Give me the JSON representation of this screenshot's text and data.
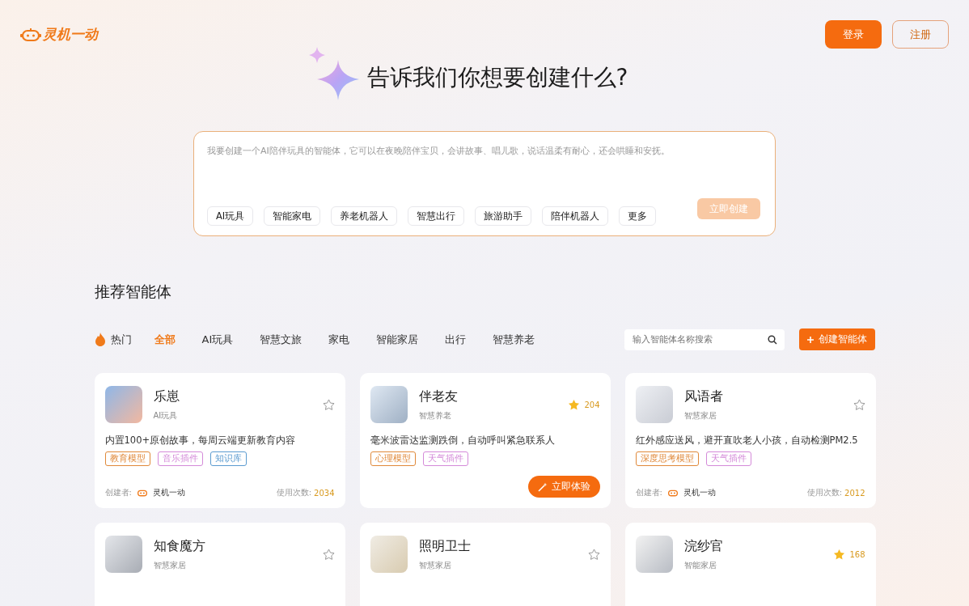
{
  "header": {
    "logo_text": "灵机一动",
    "login_button": "登录",
    "register_button": "注册"
  },
  "hero": {
    "title": "告诉我们你想要创建什么?",
    "prompt_placeholder": "我要创建一个AI陪伴玩具的智能体，它可以在夜晚陪伴宝贝，会讲故事、唱儿歌，说话温柔有耐心，还会哄睡和安抚。",
    "chips": [
      "AI玩具",
      "智能家电",
      "养老机器人",
      "智慧出行",
      "旅游助手",
      "陪伴机器人",
      "更多"
    ],
    "create_button": {
      "label": "立即创建",
      "disabled": true
    }
  },
  "section_title": "推荐智能体",
  "filter": {
    "hot_label": "热门",
    "tabs": [
      {
        "label": "全部",
        "selected": true
      },
      {
        "label": "AI玩具",
        "selected": false
      },
      {
        "label": "智慧文旅",
        "selected": false
      },
      {
        "label": "家电",
        "selected": false
      },
      {
        "label": "智能家居",
        "selected": false
      },
      {
        "label": "出行",
        "selected": false
      },
      {
        "label": "智慧养老",
        "selected": false
      }
    ],
    "search_placeholder": "输入智能体名称搜索",
    "create_agent_button": "创建智能体"
  },
  "cards": [
    {
      "name": "乐崽",
      "category": "AI玩具",
      "starred": false,
      "description": "内置100+原创故事，每周云端更新教育内容",
      "tags": [
        {
          "label": "教育模型",
          "color": "#e0893a"
        },
        {
          "label": "音乐插件",
          "color": "#d48ad9"
        },
        {
          "label": "知识库",
          "color": "#5b9bd0"
        }
      ],
      "footer": {
        "creator_label": "创建者:",
        "creator_name": "灵机一动",
        "usage_label": "使用次数:",
        "usage_count": "2034"
      }
    },
    {
      "name": "伴老友",
      "category": "智慧养老",
      "starred": true,
      "star_count": "204",
      "description": "毫米波雷达监测跌倒，自动呼叫紧急联系人",
      "tags": [
        {
          "label": "心理模型",
          "color": "#e0893a"
        },
        {
          "label": "天气插件",
          "color": "#d48ad9"
        }
      ],
      "action_button": "立即体验"
    },
    {
      "name": "风语者",
      "category": "智慧家居",
      "starred": false,
      "description": "红外感应送风，避开直吹老人小孩，自动检测PM2.5",
      "tags": [
        {
          "label": "深度思考模型",
          "color": "#e0893a"
        },
        {
          "label": "天气插件",
          "color": "#d48ad9"
        }
      ],
      "footer": {
        "creator_label": "创建者:",
        "creator_name": "灵机一动",
        "usage_label": "使用次数:",
        "usage_count": "2012"
      }
    },
    {
      "name": "知食魔方",
      "category": "智慧家居",
      "starred": false
    },
    {
      "name": "照明卫士",
      "category": "智慧家居",
      "starred": false
    },
    {
      "name": "浣纱官",
      "category": "智能家居",
      "starred": true,
      "star_count": "168"
    }
  ]
}
